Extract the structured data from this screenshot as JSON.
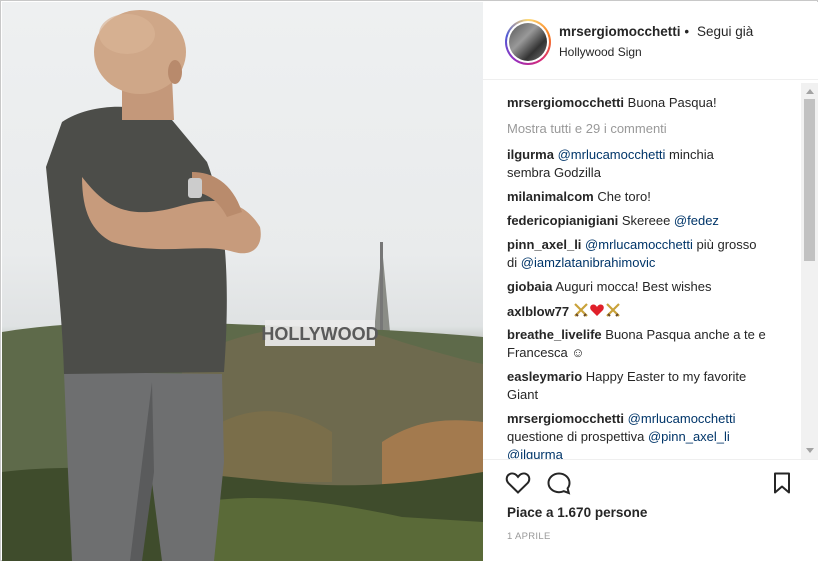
{
  "header": {
    "username": "mrsergiomocchetti",
    "separator": "•",
    "follow_label": "Segui già",
    "location": "Hollywood Sign"
  },
  "caption": {
    "username": "mrsergiomocchetti",
    "text": "Buona Pasqua!"
  },
  "show_all_comments": "Mostra tutti e 29 i commenti",
  "comments": [
    {
      "user": "ilgurma",
      "mention": "@mrlucamocchetti",
      "text1": " minchia",
      "text2": "sembra Godzilla"
    },
    {
      "user": "milanimalcom",
      "text": "Che toro!"
    },
    {
      "user": "federicopianigiani",
      "text": "Skereee",
      "mention": "@fedez"
    },
    {
      "user": "pinn_axel_li",
      "mention": "@mrlucamocchetti",
      "text1": " più grosso",
      "text2": "di",
      "mention2": "@iamzlatanibrahimovic"
    },
    {
      "user": "giobaia",
      "text": "Auguri mocca! Best wishes"
    },
    {
      "user": "axlblow77",
      "text": ""
    },
    {
      "user": "breathe_livelife",
      "text1": "Buona Pasqua anche a te e",
      "text2": "Francesca ☺"
    },
    {
      "user": "easleymario",
      "text1": "Happy Easter to my favorite",
      "text2": "Giant"
    },
    {
      "user": "mrsergiomocchetti",
      "mention": "@mrlucamocchetti",
      "text2": "questione di prospettiva",
      "mention2": "@pinn_axel_li",
      "mention3": "@ilgurma"
    }
  ],
  "likes": "Piace a 1.670 persone",
  "date": "1 APRILE",
  "photo_sign": "HOLLYWOOD",
  "icons": {
    "like": "heart-icon",
    "comment": "comment-bubble-icon",
    "save": "bookmark-icon"
  },
  "colors": {
    "mention": "#003569",
    "muted": "#999999",
    "text": "#262626"
  }
}
